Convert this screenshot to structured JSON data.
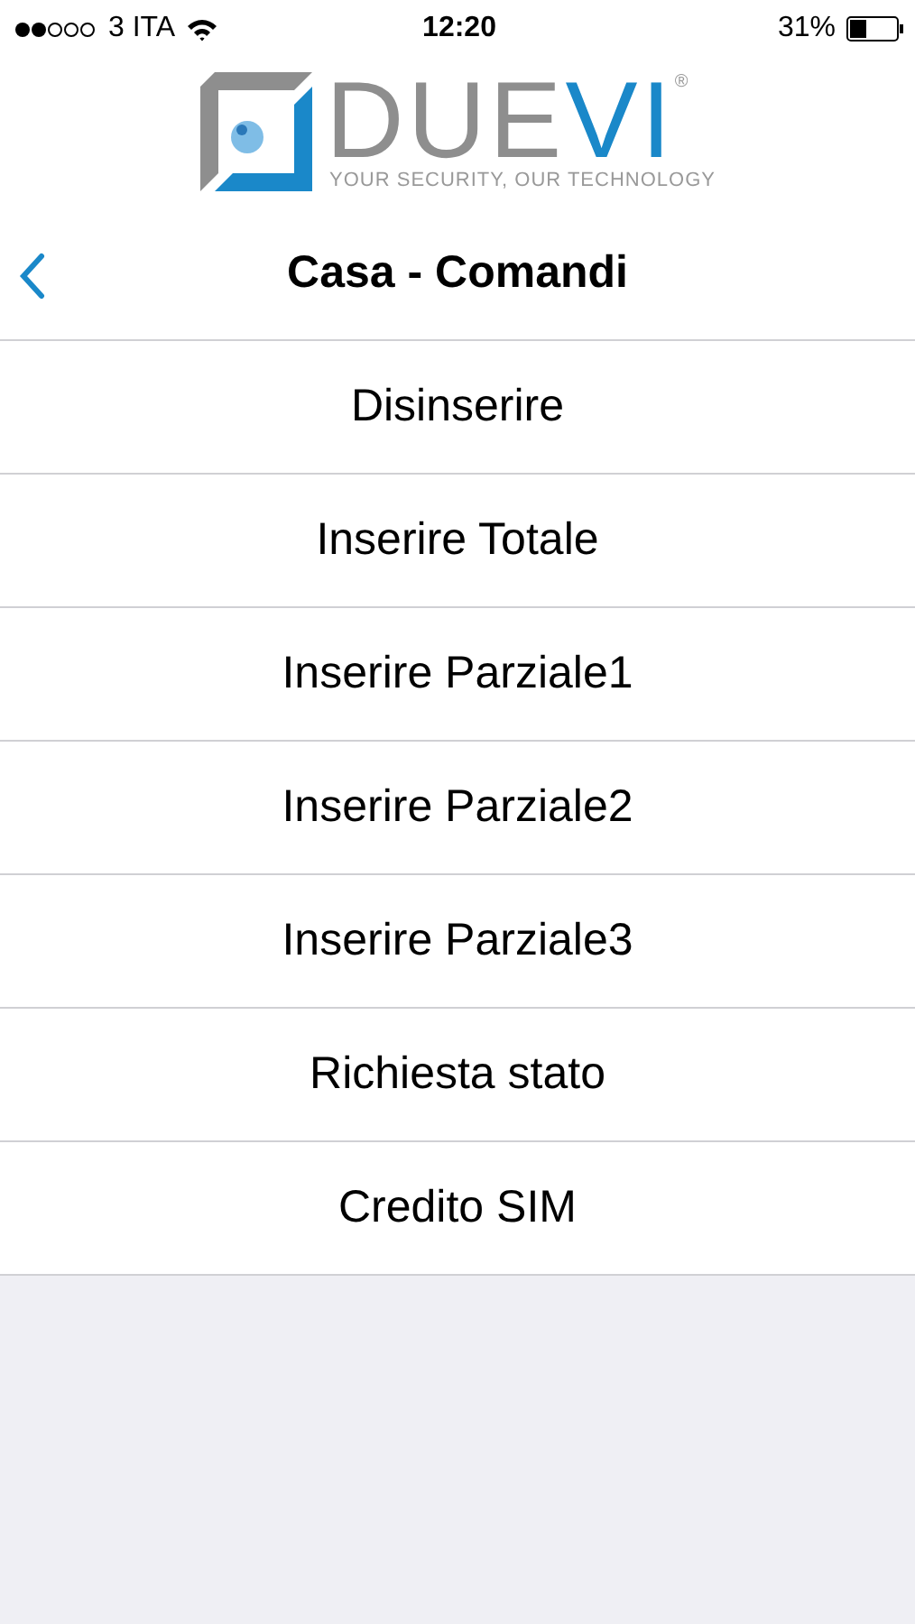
{
  "status_bar": {
    "carrier": "3 ITA",
    "time": "12:20",
    "battery": "31%"
  },
  "logo": {
    "parts": [
      {
        "text": "DUE",
        "color": "#8e8e8e"
      },
      {
        "text": "VI",
        "color": "#1a88c9"
      }
    ],
    "registered": "®",
    "tagline": "YOUR SECURITY, OUR TECHNOLOGY"
  },
  "nav": {
    "title": "Casa - Comandi"
  },
  "commands": [
    "Disinserire",
    "Inserire Totale",
    "Inserire Parziale1",
    "Inserire Parziale2",
    "Inserire Parziale3",
    "Richiesta stato",
    "Credito SIM"
  ]
}
